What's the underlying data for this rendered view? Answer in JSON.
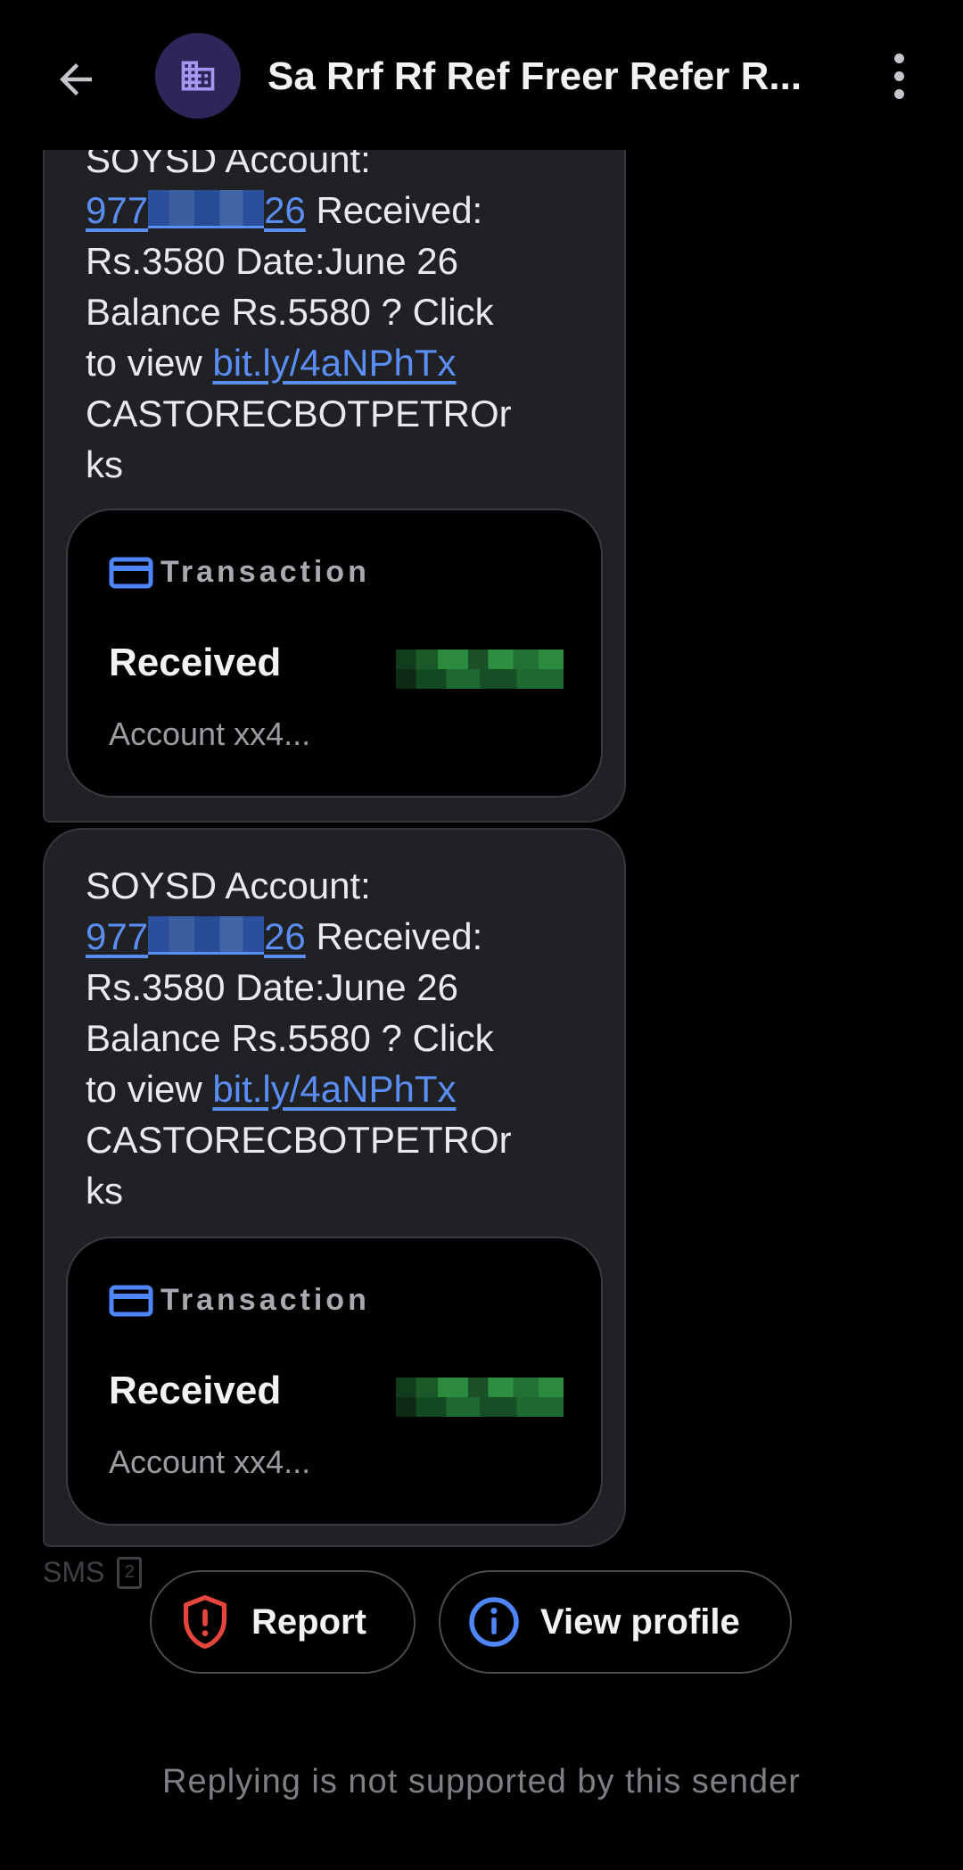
{
  "header": {
    "title": "Sa Rrf Rf Ref Freer Refer R...",
    "back_icon": "arrow-left-icon",
    "avatar_icon": "building-icon",
    "avatar_bg": "#2f2559",
    "more_icon": "more-vert-icon"
  },
  "messages": [
    {
      "lines": {
        "l1": "SOYSD Account:",
        "num_start": "977",
        "num_end": "26",
        "l2_rest": " Received:",
        "l3": "Rs.3580 Date:June 26",
        "l4": "Balance Rs.5580 ? Click",
        "l5_prefix": "to view ",
        "link": "bit.ly/4aNPhTx",
        "l6": "CASTORECBOTPETROr",
        "l7": "ks"
      },
      "card": {
        "label": "Transaction",
        "status": "Received",
        "account": "Account xx4..."
      }
    },
    {
      "lines": {
        "l1": "SOYSD Account:",
        "num_start": "977",
        "num_end": "26",
        "l2_rest": " Received:",
        "l3": "Rs.3580 Date:June 26",
        "l4": "Balance Rs.5580 ? Click",
        "l5_prefix": "to view ",
        "link": "bit.ly/4aNPhTx",
        "l6": "CASTORECBOTPETROr",
        "l7": "ks"
      },
      "card": {
        "label": "Transaction",
        "status": "Received",
        "account": "Account xx4..."
      }
    }
  ],
  "meta": {
    "channel": "SMS",
    "sim": "2"
  },
  "actions": {
    "report_label": "Report",
    "profile_label": "View profile"
  },
  "footer": {
    "note": "Replying is not supported by this sender"
  },
  "colors": {
    "link": "#5b8ef5",
    "report_icon": "#e5463b",
    "profile_icon": "#4f86f7",
    "card_icon": "#4f86f7"
  }
}
